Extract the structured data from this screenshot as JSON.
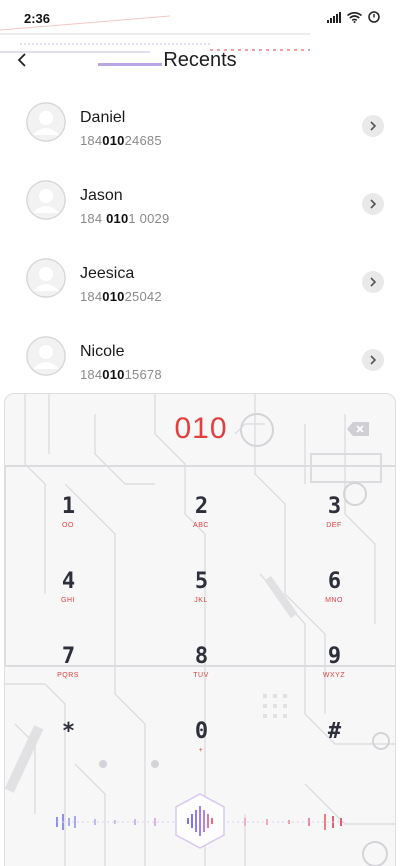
{
  "status_bar": {
    "time": "2:36",
    "icons": [
      "signal-icon",
      "wifi-icon",
      "alarm-icon"
    ]
  },
  "header": {
    "title": "Recents",
    "back_icon": "chevron-left-icon"
  },
  "contacts": [
    {
      "name": "Daniel",
      "number_pre": "184",
      "number_match": "010",
      "number_post": "24685"
    },
    {
      "name": "Jason",
      "number_pre": "184 ",
      "number_match": "010",
      "number_post": "1 0029"
    },
    {
      "name": "Jeesica",
      "number_pre": "184",
      "number_match": "010",
      "number_post": "25042"
    },
    {
      "name": "Nicole",
      "number_pre": "184",
      "number_match": "010",
      "number_post": "15678"
    }
  ],
  "dialpad": {
    "display": "010",
    "keys": [
      {
        "digit": "1",
        "letters": "OO"
      },
      {
        "digit": "2",
        "letters": "ABC"
      },
      {
        "digit": "3",
        "letters": "DEF"
      },
      {
        "digit": "4",
        "letters": "GHI"
      },
      {
        "digit": "5",
        "letters": "JKL"
      },
      {
        "digit": "6",
        "letters": "MNO"
      },
      {
        "digit": "7",
        "letters": "PQRS"
      },
      {
        "digit": "8",
        "letters": "TUV"
      },
      {
        "digit": "9",
        "letters": "WXYZ"
      },
      {
        "digit": "*",
        "letters": ""
      },
      {
        "digit": "0",
        "letters": "+"
      },
      {
        "digit": "#",
        "letters": ""
      }
    ]
  },
  "colors": {
    "accent": "#e0413e",
    "key_text": "#2d2f3a",
    "call_button": "#6a5ff0"
  }
}
